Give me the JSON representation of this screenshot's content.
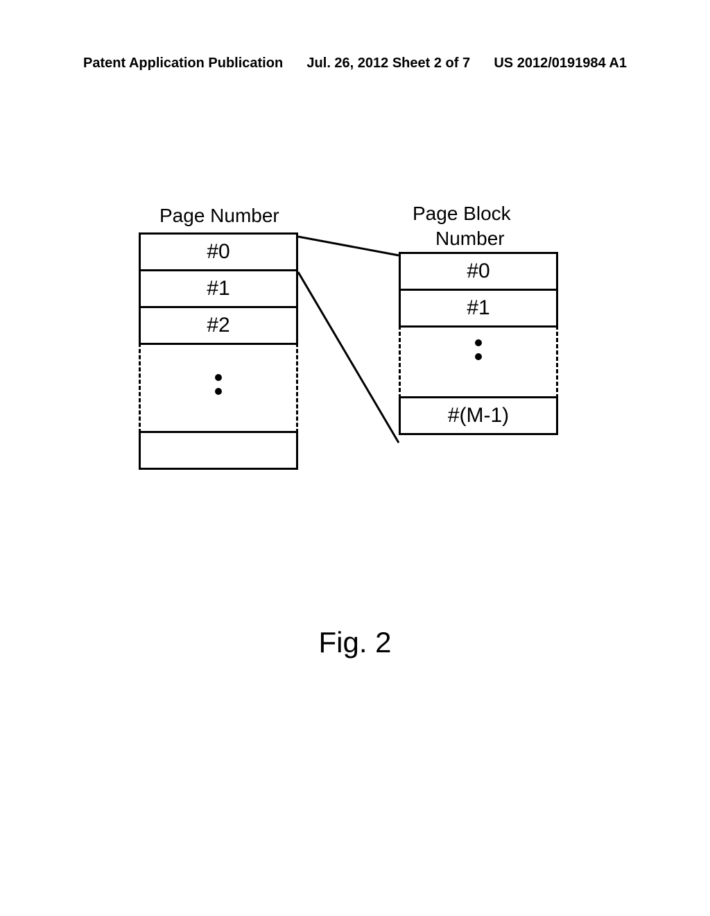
{
  "header": {
    "left": "Patent Application Publication",
    "center": "Jul. 26, 2012  Sheet 2 of 7",
    "right": "US 2012/0191984 A1"
  },
  "diagram": {
    "left_title": "Page Number",
    "right_title_line1": "Page Block",
    "right_title_line2": "Number",
    "left_cells": [
      "#0",
      "#1",
      "#2"
    ],
    "right_cells": [
      "#0",
      "#1"
    ],
    "right_last_cell": "#(M-1)"
  },
  "figure_label": "Fig. 2"
}
